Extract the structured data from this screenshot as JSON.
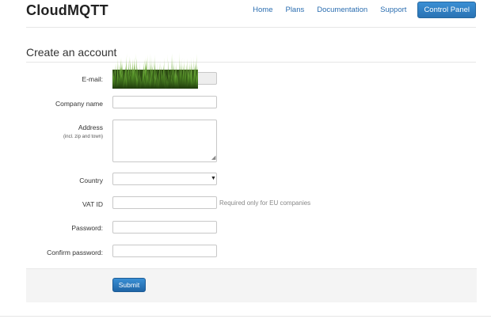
{
  "header": {
    "brand": "CloudMQTT",
    "nav": [
      {
        "label": "Home"
      },
      {
        "label": "Plans"
      },
      {
        "label": "Documentation"
      },
      {
        "label": "Support"
      }
    ],
    "control_panel_label": "Control Panel"
  },
  "form": {
    "title": "Create an account",
    "email_label": "E-mail:",
    "email_value": "",
    "company_label": "Company name",
    "company_value": "",
    "address_label": "Address",
    "address_sublabel": "(incl. zip and town)",
    "address_value": "",
    "country_label": "Country",
    "country_value": "",
    "vat_label": "VAT ID",
    "vat_value": "",
    "vat_help": "Required only for EU companies",
    "password_label": "Password:",
    "confirm_label": "Confirm password:",
    "submit_label": "Submit"
  },
  "colors": {
    "link": "#2a6db0",
    "primary_button": "#2f7fc1",
    "footer_bg": "#f4f4f4"
  },
  "icons": {
    "select_arrow": "caret-down-icon",
    "resize_grip": "resize-grip-icon"
  }
}
